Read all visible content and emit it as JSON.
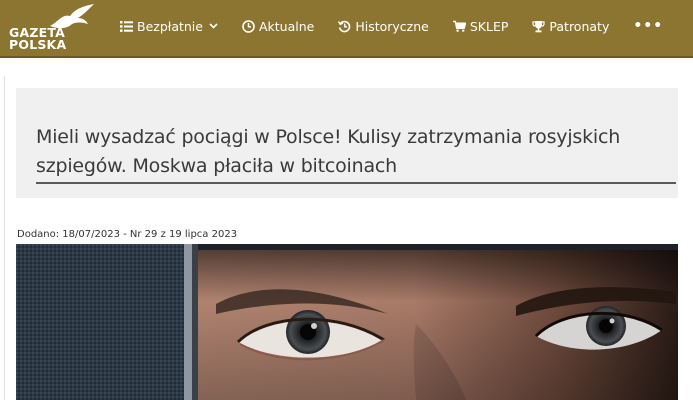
{
  "logo": {
    "line1": "GAZETA",
    "line2": "POLSKA"
  },
  "nav": {
    "items": [
      {
        "label": "Bezpłatnie",
        "icon": "list-icon",
        "has_dropdown": true
      },
      {
        "label": "Aktualne",
        "icon": "clock-icon"
      },
      {
        "label": "Historyczne",
        "icon": "history-icon"
      },
      {
        "label": "SKLEP",
        "icon": "cart-icon"
      },
      {
        "label": "Patronaty",
        "icon": "trophy-icon"
      }
    ],
    "more_label": "•••"
  },
  "article": {
    "title": "Mieli wysadzać pociągi w Polsce! Kulisy zatrzymania rosyjskich szpiegów. Moskwa płaciła w bitcoinach",
    "meta": "Dodano: 18/07/2023 - Nr 29 z 19 lipca 2023"
  },
  "colors": {
    "header_bg": "#8c7530",
    "title_box_bg": "#f0f0f0",
    "text": "#3a3a3a"
  }
}
